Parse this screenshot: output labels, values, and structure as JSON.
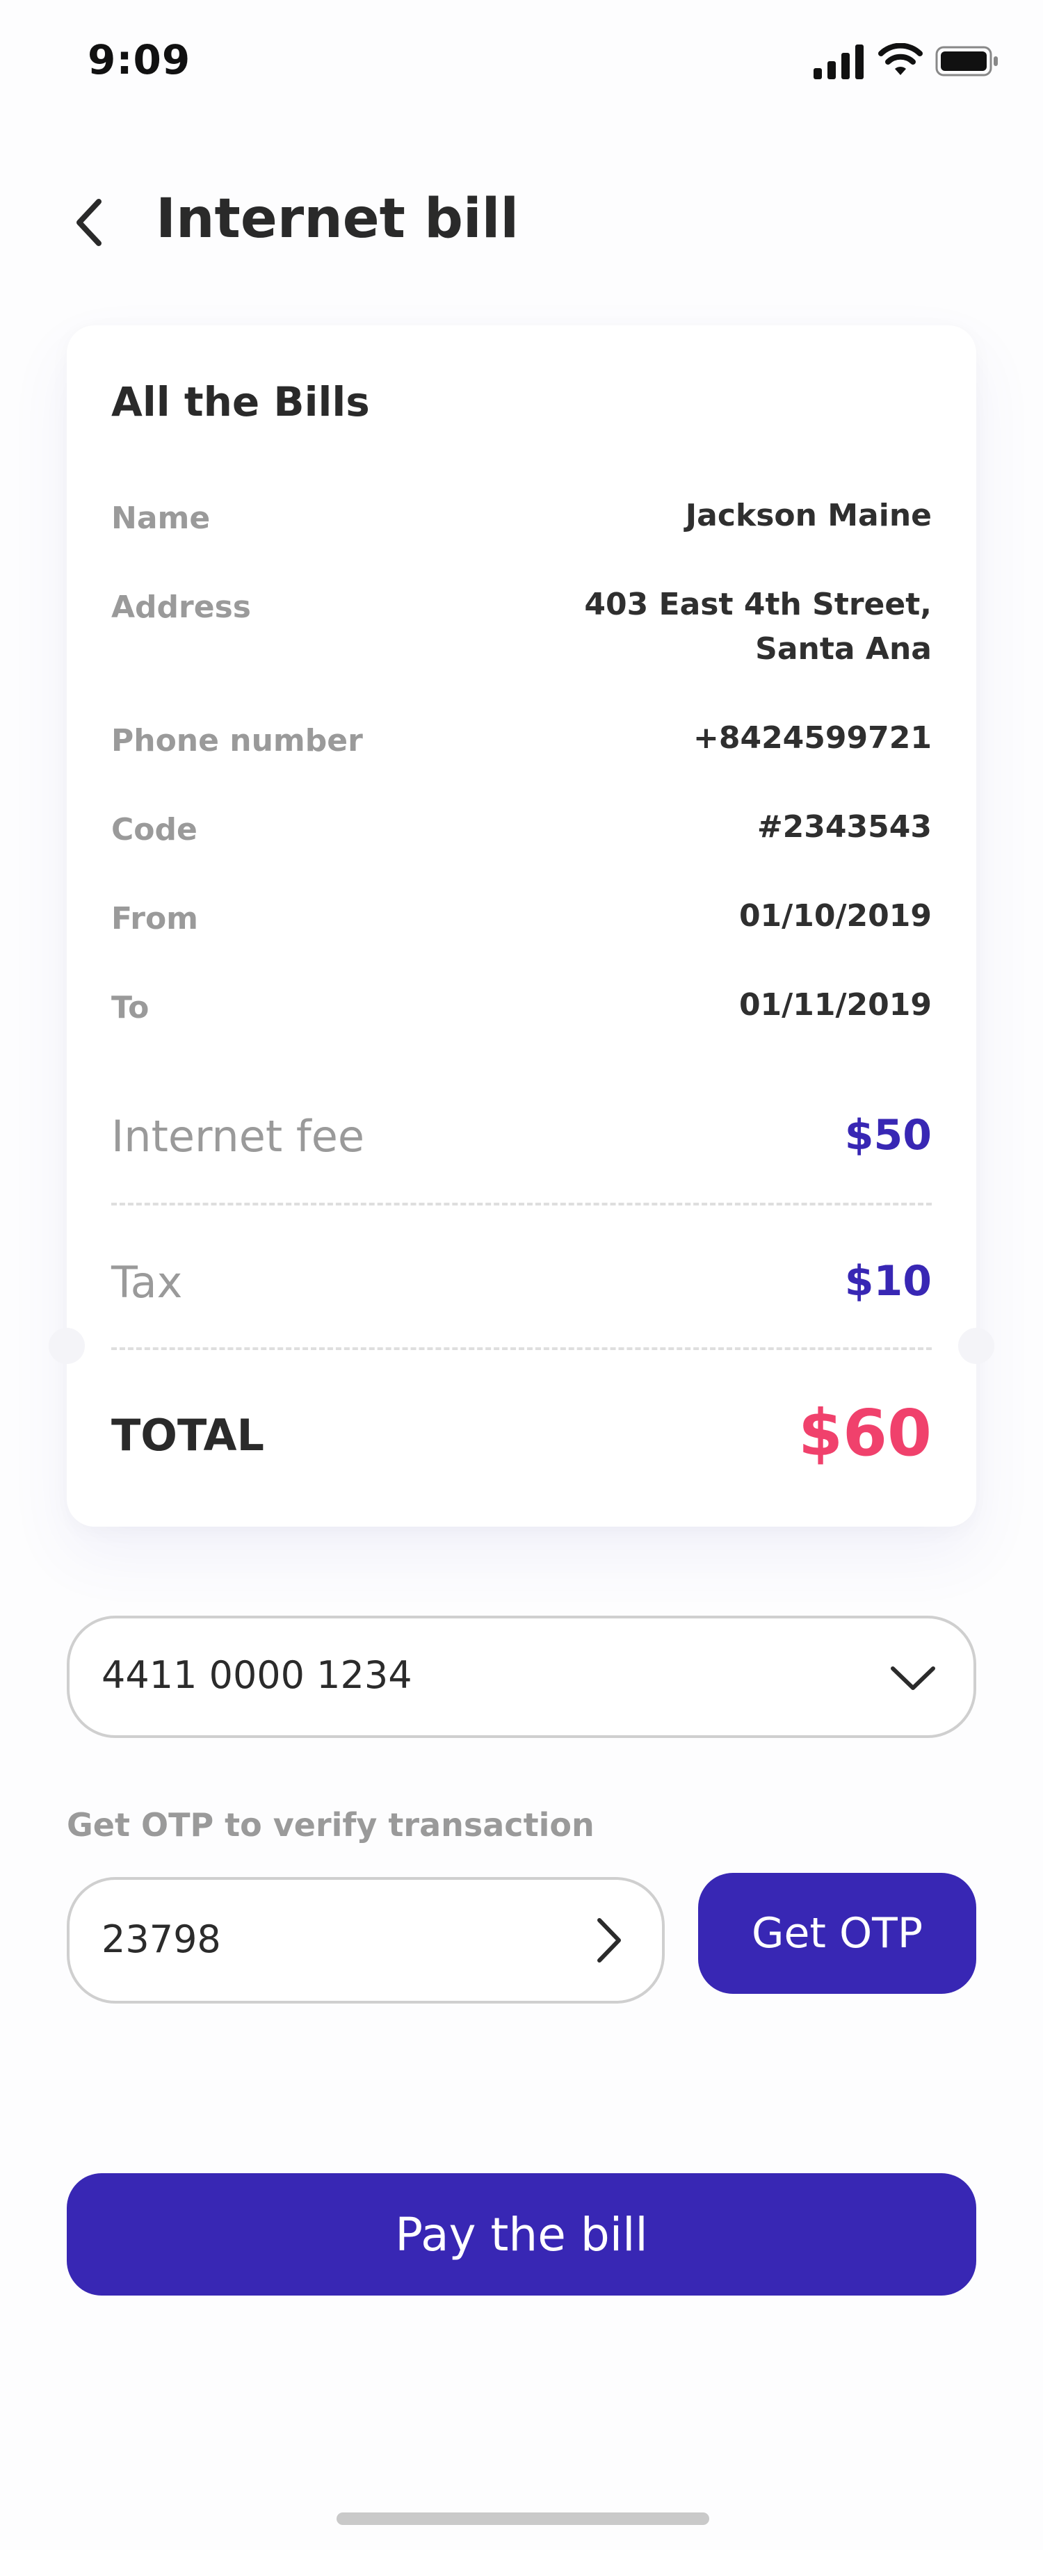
{
  "status_bar": {
    "time": "9:09"
  },
  "header": {
    "title": "Internet bill"
  },
  "bill": {
    "title": "All the Bills",
    "rows": [
      {
        "label": "Name",
        "value": "Jackson Maine"
      },
      {
        "label": "Address",
        "value_line1": "403 East 4th Street,",
        "value_line2": "Santa Ana"
      },
      {
        "label": "Phone number",
        "value": "+8424599721"
      },
      {
        "label": "Code",
        "value": "#2343543"
      },
      {
        "label": "From",
        "value": "01/10/2019"
      },
      {
        "label": "To",
        "value": "01/11/2019"
      }
    ],
    "fees": [
      {
        "label": "Internet fee",
        "value": "$50"
      },
      {
        "label": "Tax",
        "value": "$10"
      }
    ],
    "total_label": "TOTAL",
    "total_value": "$60"
  },
  "payment": {
    "card_number": "4411 0000 1234",
    "otp_label": "Get OTP to verify transaction",
    "otp_value": "23798",
    "get_otp_label": "Get OTP",
    "pay_label": "Pay the bill"
  },
  "colors": {
    "primary": "#3827b4",
    "total": "#f0416c"
  }
}
